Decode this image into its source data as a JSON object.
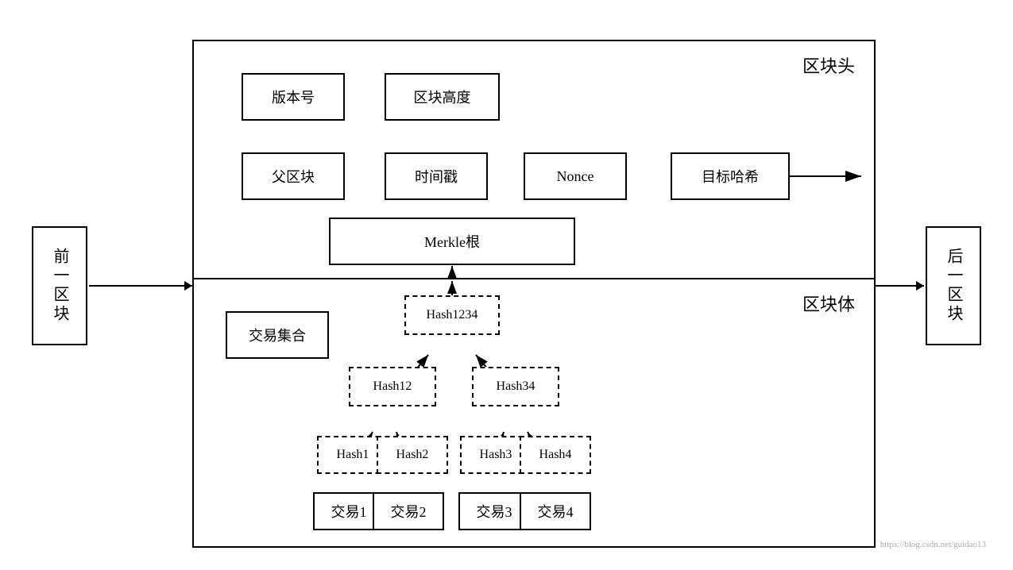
{
  "prev_block": {
    "label": "前一区块"
  },
  "next_block": {
    "label": "后一区块"
  },
  "block_header": {
    "label": "区块头",
    "boxes": [
      {
        "id": "version",
        "label": "版本号"
      },
      {
        "id": "height",
        "label": "区块高度"
      },
      {
        "id": "parent",
        "label": "父区块"
      },
      {
        "id": "timestamp",
        "label": "时间戳"
      },
      {
        "id": "nonce",
        "label": "Nonce"
      },
      {
        "id": "target",
        "label": "目标哈希"
      },
      {
        "id": "merkle",
        "label": "Merkle根"
      }
    ]
  },
  "block_body": {
    "label": "区块体",
    "tx_set": "交易集合",
    "hashes": {
      "hash1234": "Hash1234",
      "hash12": "Hash12",
      "hash34": "Hash34",
      "hash1": "Hash1",
      "hash2": "Hash2",
      "hash3": "Hash3",
      "hash4": "Hash4"
    },
    "transactions": {
      "tx1": "交易1",
      "tx2": "交易2",
      "tx3": "交易3",
      "tx4": "交易4"
    }
  },
  "watermark": "https://blog.csdn.net/guidao13"
}
